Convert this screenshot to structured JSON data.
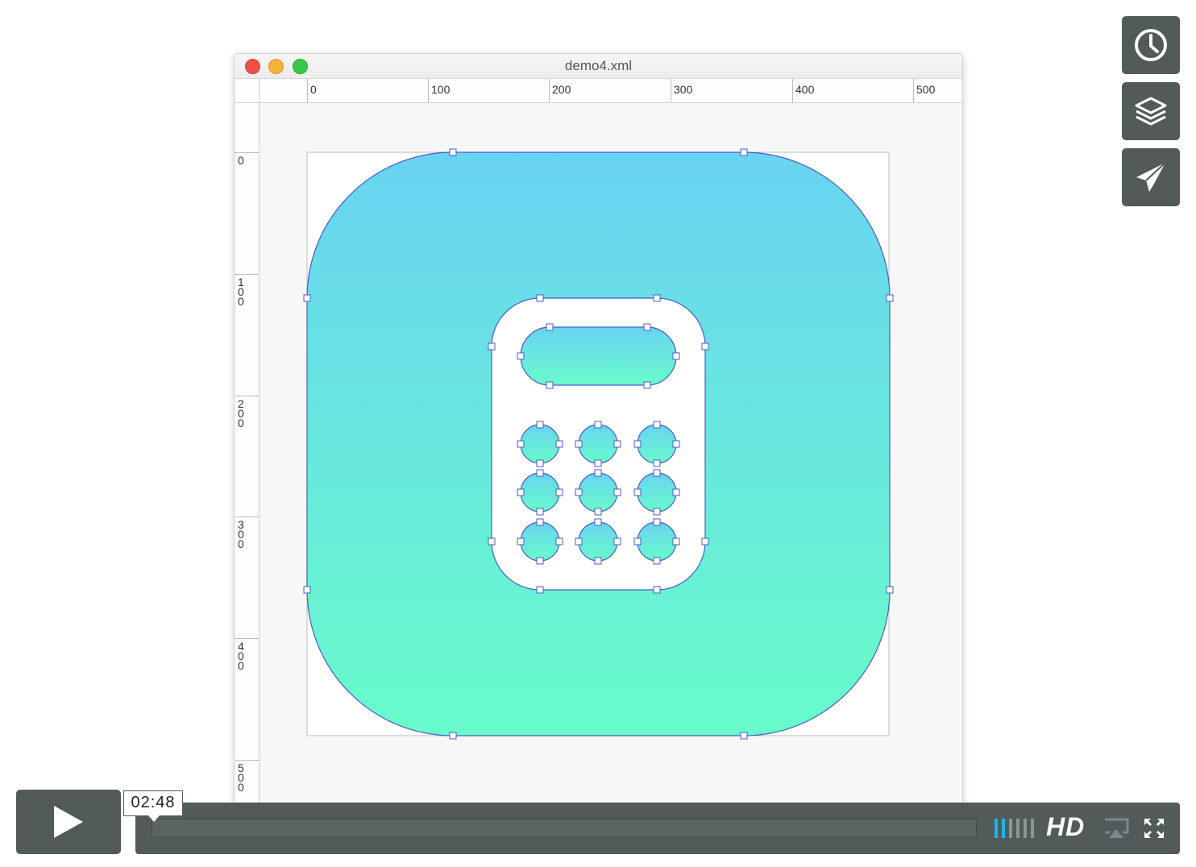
{
  "window": {
    "title": "demo4.xml"
  },
  "rulers": {
    "horizontal": [
      "0",
      "100",
      "200",
      "300",
      "400",
      "500"
    ],
    "vertical": [
      "0",
      "100",
      "200",
      "300",
      "400",
      "500"
    ]
  },
  "canvas": {
    "gradient_top": "#68d3f1",
    "gradient_bottom": "#68fcca",
    "outline": "#4a5cc7"
  },
  "side_buttons": [
    {
      "icon": "clock-icon"
    },
    {
      "icon": "layers-icon"
    },
    {
      "icon": "paper-plane-icon"
    }
  ],
  "player": {
    "time": "02:48",
    "hd_label": "HD",
    "play_icon": "play-icon",
    "airplay_icon": "airplay-icon",
    "fullscreen_icon": "fullscreen-icon"
  }
}
